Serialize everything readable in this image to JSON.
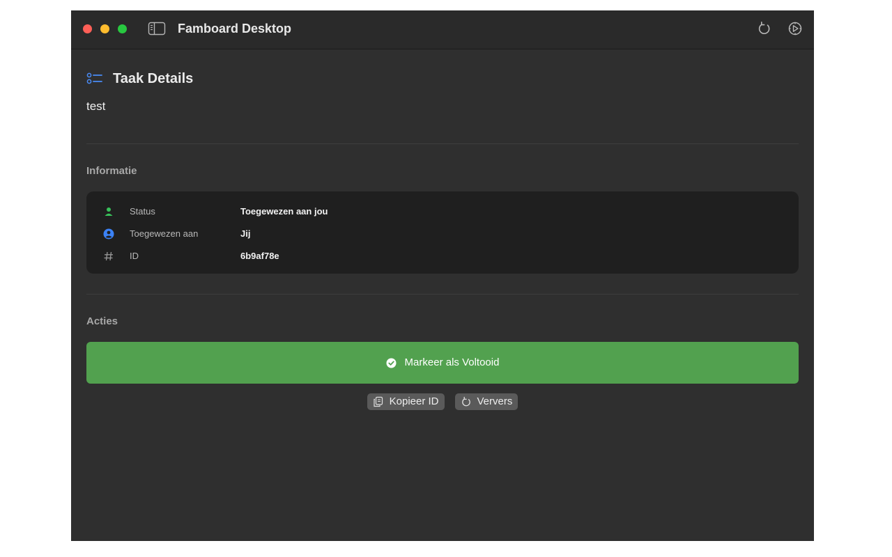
{
  "window": {
    "title": "Famboard Desktop"
  },
  "header": {
    "title": "Taak Details",
    "task_name": "test"
  },
  "info_section": {
    "label": "Informatie",
    "rows": [
      {
        "icon": "person-icon",
        "icon_color": "#38c15a",
        "label": "Status",
        "value": "Toegewezen aan jou"
      },
      {
        "icon": "person-circle-icon",
        "icon_color": "#3b82f6",
        "label": "Toegewezen aan",
        "value": "Jij"
      },
      {
        "icon": "hash-icon",
        "icon_color": "#9a9a9a",
        "label": "ID",
        "value": "6b9af78e"
      }
    ]
  },
  "actions_section": {
    "label": "Acties",
    "complete_button": "Markeer als Voltooid",
    "copy_id_button": "Kopieer ID",
    "refresh_button": "Ververs"
  },
  "colors": {
    "window_bg": "#2f2f2f",
    "card_bg": "#1f1f1f",
    "success_green": "#52a14f",
    "secondary_button": "#5a5a5a"
  }
}
